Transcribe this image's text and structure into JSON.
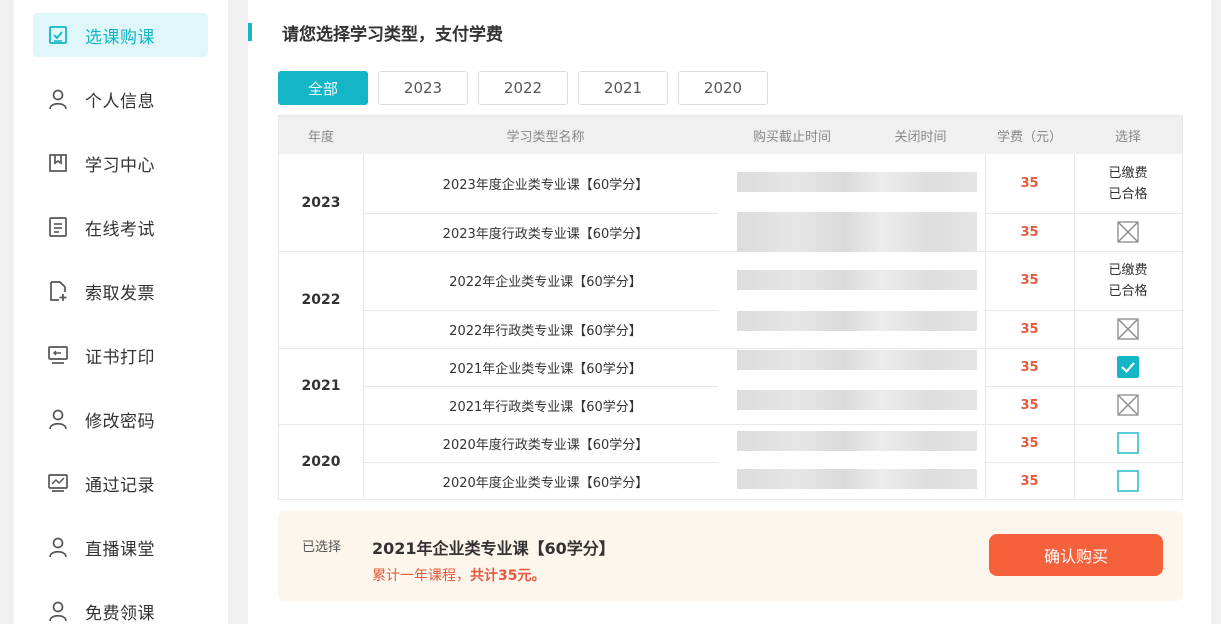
{
  "sidebar": {
    "items": [
      {
        "label": "选课购课",
        "icon": "checkbox-icon",
        "active": true
      },
      {
        "label": "个人信息",
        "icon": "user-icon"
      },
      {
        "label": "学习中心",
        "icon": "bookmark-icon"
      },
      {
        "label": "在线考试",
        "icon": "document-icon"
      },
      {
        "label": "索取发票",
        "icon": "file-add-icon"
      },
      {
        "label": "证书打印",
        "icon": "monitor-icon"
      },
      {
        "label": "修改密码",
        "icon": "user-icon"
      },
      {
        "label": "通过记录",
        "icon": "chart-icon"
      },
      {
        "label": "直播课堂",
        "icon": "user-icon"
      },
      {
        "label": "免费领课",
        "icon": "user-icon"
      }
    ]
  },
  "main": {
    "title": "请您选择学习类型，支付学费",
    "tabs": [
      {
        "label": "全部",
        "active": true
      },
      {
        "label": "2023"
      },
      {
        "label": "2022"
      },
      {
        "label": "2021"
      },
      {
        "label": "2020"
      }
    ],
    "table": {
      "headers": [
        "年度",
        "学习类型名称",
        "购买截止时间",
        "关闭时间",
        "学费（元）",
        "选择"
      ],
      "groups": [
        {
          "year": "2023",
          "rows": [
            {
              "name": "2023年度企业类专业课【60学分】",
              "fee": "35",
              "status": [
                "已缴费",
                "已合格"
              ]
            },
            {
              "name": "2023年度行政类专业课【60学分】",
              "fee": "35",
              "select": "disabled"
            }
          ]
        },
        {
          "year": "2022",
          "rows": [
            {
              "name": "2022年企业类专业课【60学分】",
              "fee": "35",
              "status": [
                "已缴费",
                "已合格"
              ]
            },
            {
              "name": "2022年行政类专业课【60学分】",
              "fee": "35",
              "select": "disabled"
            }
          ]
        },
        {
          "year": "2021",
          "rows": [
            {
              "name": "2021年企业类专业课【60学分】",
              "fee": "35",
              "select": "checked"
            },
            {
              "name": "2021年行政类专业课【60学分】",
              "fee": "35",
              "select": "disabled"
            }
          ]
        },
        {
          "year": "2020",
          "rows": [
            {
              "name": "2020年度行政类专业课【60学分】",
              "fee": "35",
              "select": "unchecked"
            },
            {
              "name": "2020年度企业类专业课【60学分】",
              "fee": "35",
              "select": "unchecked"
            }
          ]
        }
      ]
    },
    "summary": {
      "label": "已选择",
      "course": "2021年企业类专业课【60学分】",
      "total_prefix": "累计一年课程，",
      "total_amount": "共计35元。",
      "buy_label": "确认购买"
    }
  },
  "colors": {
    "accent": "#13b5c6",
    "fee": "#e65a3c",
    "button": "#f4613b",
    "summary_bg": "#fdf6ec"
  }
}
